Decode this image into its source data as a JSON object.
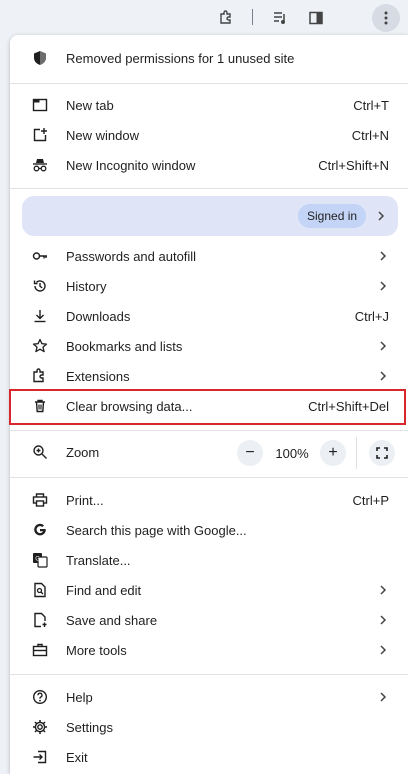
{
  "toolbar": {
    "icons": [
      "extensions-icon",
      "media-controls-icon",
      "side-panel-icon",
      "more-menu-icon"
    ]
  },
  "menu": {
    "permissions_notice": "Removed permissions for 1 unused site",
    "new_tab": {
      "label": "New tab",
      "shortcut": "Ctrl+T"
    },
    "new_window": {
      "label": "New window",
      "shortcut": "Ctrl+N"
    },
    "new_incognito": {
      "label": "New Incognito window",
      "shortcut": "Ctrl+Shift+N"
    },
    "profile": {
      "status": "Signed in"
    },
    "passwords": {
      "label": "Passwords and autofill"
    },
    "history": {
      "label": "History"
    },
    "downloads": {
      "label": "Downloads",
      "shortcut": "Ctrl+J"
    },
    "bookmarks": {
      "label": "Bookmarks and lists"
    },
    "extensions": {
      "label": "Extensions"
    },
    "clear_data": {
      "label": "Clear browsing data...",
      "shortcut": "Ctrl+Shift+Del"
    },
    "zoom": {
      "label": "Zoom",
      "value": "100%",
      "minus": "−",
      "plus": "+"
    },
    "print": {
      "label": "Print...",
      "shortcut": "Ctrl+P"
    },
    "search_google": {
      "label": "Search this page with Google..."
    },
    "translate": {
      "label": "Translate..."
    },
    "find_edit": {
      "label": "Find and edit"
    },
    "save_share": {
      "label": "Save and share"
    },
    "more_tools": {
      "label": "More tools"
    },
    "help": {
      "label": "Help"
    },
    "settings": {
      "label": "Settings"
    },
    "exit": {
      "label": "Exit"
    }
  },
  "colors": {
    "highlight_border": "#d8262d",
    "profile_bg": "#dfe5f7",
    "badge_bg": "#c4d4f6"
  }
}
